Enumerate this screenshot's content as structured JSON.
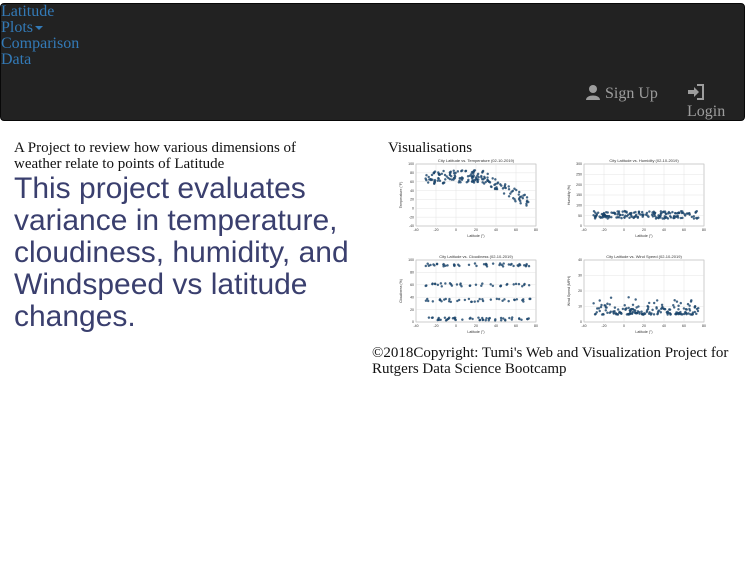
{
  "nav": {
    "links": [
      "Latitude",
      "Plots",
      "Comparison",
      "Data"
    ],
    "signup_label": "Sign Up",
    "login_label": "Login"
  },
  "intro": {
    "lead": "A Project to review how various dimensions of weather relate to points of Latitude",
    "headline": "This project evaluates variance in temperature, cloudiness, humidity, and Windspeed vs latitude changes."
  },
  "visualisations": {
    "title": "Visualisations",
    "plots": [
      {
        "title": "City Latitude vs. Temperature (02-10-2019)",
        "xlabel": "Latitude (°)",
        "ylabel": "Temperature (°F)",
        "yticks": [
          "100",
          "80",
          "60",
          "40",
          "20",
          "0",
          "-20",
          "-40"
        ],
        "xticks": [
          "-40",
          "-20",
          "0",
          "20",
          "40",
          "60",
          "80"
        ]
      },
      {
        "title": "City Latitude vs. Humidity (02-10-2019)",
        "xlabel": "Latitude (°)",
        "ylabel": "Humidity (%)",
        "yticks": [
          "300",
          "250",
          "200",
          "150",
          "100",
          "50",
          "0"
        ],
        "xticks": [
          "-40",
          "-20",
          "0",
          "20",
          "40",
          "60",
          "80"
        ]
      },
      {
        "title": "City Latitude vs. Cloudiness (02-10-2019)",
        "xlabel": "Latitude (°)",
        "ylabel": "Cloudiness (%)",
        "yticks": [
          "100",
          "80",
          "60",
          "40",
          "20",
          "0"
        ],
        "xticks": [
          "-40",
          "-20",
          "0",
          "20",
          "40",
          "60",
          "80"
        ]
      },
      {
        "title": "City Latitude vs. Wind Speed (02-10-2019)",
        "xlabel": "Latitude (°)",
        "ylabel": "Wind Speed (MPH)",
        "yticks": [
          "40",
          "30",
          "20",
          "10",
          "0"
        ],
        "xticks": [
          "-40",
          "-20",
          "0",
          "20",
          "40",
          "60",
          "80"
        ]
      }
    ]
  },
  "footer": {
    "text": "©2018Copyright: Tumi's Web and Visualization Project for Rutgers Data Science Bootcamp"
  },
  "colors": {
    "navbar": "#222222",
    "link": "#337ab7",
    "headline": "#3a3f6e",
    "point": "#1f4e79"
  }
}
